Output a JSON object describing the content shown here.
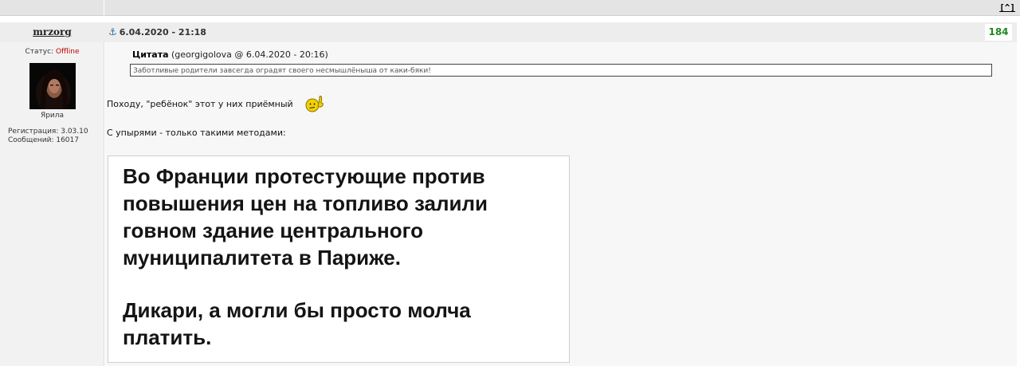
{
  "top": {
    "scroll_top_label": "[^]"
  },
  "post": {
    "author": "mrzorg",
    "timestamp": "6.04.2020 - 21:18",
    "number": "184",
    "status_label": "Статус:",
    "status_value": "Offline",
    "rank": "Ярила",
    "registration": "Регистрация: 3.03.10",
    "messages": "Сообщений: 16017",
    "quote": {
      "label": "Цитата",
      "source": "(georgigolova @ 6.04.2020 - 20:16)",
      "text": "Заботливые родители завсегда оградят своего несмышлёныша от каки-бяки!"
    },
    "paragraph1": "Походу, \"ребёнок\" этот у них приёмный",
    "paragraph2": "С упырями - только такими методами:",
    "image_text": {
      "line1": "Во Франции протестующие против",
      "line2": "повышения цен на топливо залили",
      "line3": "говном  здание центрального",
      "line4": "муниципалитета в Париже.",
      "line5": "Дикари, а могли бы просто молча",
      "line6": "платить."
    }
  },
  "colors": {
    "offline": "#c00000",
    "post_number": "#1f8a1f",
    "header_bg": "#ededed",
    "anchor": "#2d6e9a"
  },
  "icons": {
    "anchor": "anchor-icon",
    "smiley": "thinking-smiley-icon"
  }
}
